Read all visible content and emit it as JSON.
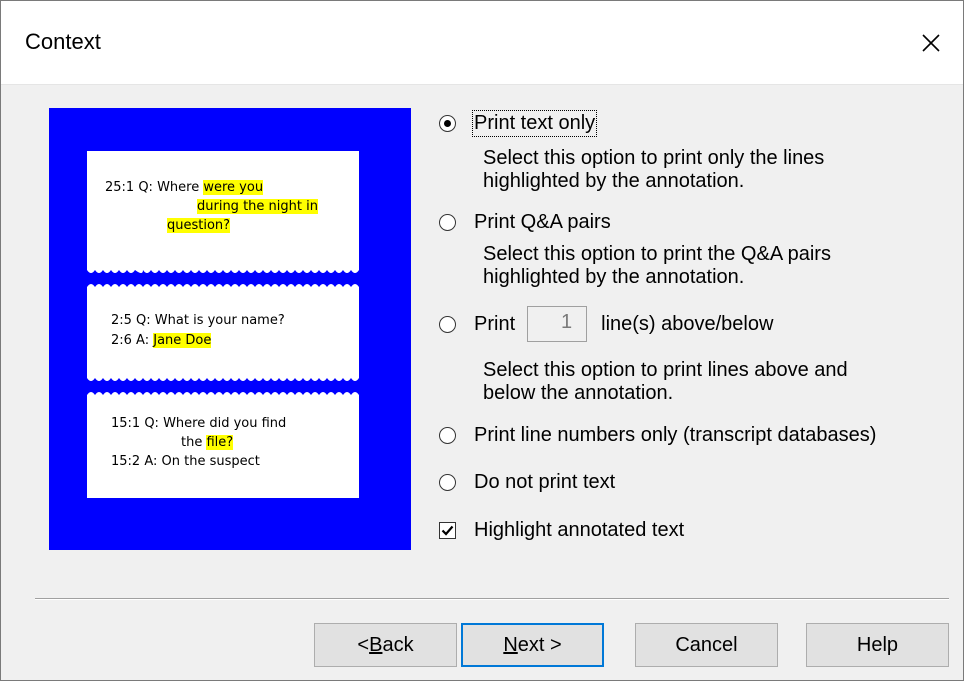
{
  "window": {
    "title": "Context"
  },
  "preview": {
    "card1": {
      "l1_ref": "25:1 Q: Where ",
      "l1_hl": "were you",
      "l2_hl": "during the night in",
      "l3_hl": "question?"
    },
    "card2": {
      "l1": "2:5 Q:  What is your name?",
      "l2_ref": "2:6 A:  ",
      "l2_hl": "Jane Doe"
    },
    "card3": {
      "l1": "15:1 Q: Where did you find",
      "l2_ref": "the ",
      "l2_hl": "file?",
      "l3": "15:2 A: On the suspect"
    }
  },
  "options": {
    "print_text_only": {
      "label": "Print text only",
      "desc1": "Select this option to print only the lines",
      "desc2": "highlighted by the annotation.",
      "checked": true
    },
    "print_qa_pairs": {
      "label": "Print Q&A pairs",
      "desc1": "Select this option to print the Q&A pairs",
      "desc2": "highlighted by the annotation.",
      "checked": false
    },
    "print_lines": {
      "label_pre": "Print",
      "value": "1",
      "label_post": "line(s) above/below",
      "desc1": "Select this option to print lines above and",
      "desc2": "below the annotation.",
      "checked": false
    },
    "print_line_numbers": {
      "label": "Print line numbers only (transcript databases)",
      "checked": false
    },
    "do_not_print": {
      "label": "Do not print text",
      "checked": false
    },
    "highlight": {
      "label": "Highlight annotated text",
      "checked": true
    }
  },
  "buttons": {
    "back": {
      "pre": "< ",
      "accel": "B",
      "post": "ack"
    },
    "next": {
      "accel": "N",
      "post": "ext >"
    },
    "cancel": "Cancel",
    "help": "Help"
  }
}
